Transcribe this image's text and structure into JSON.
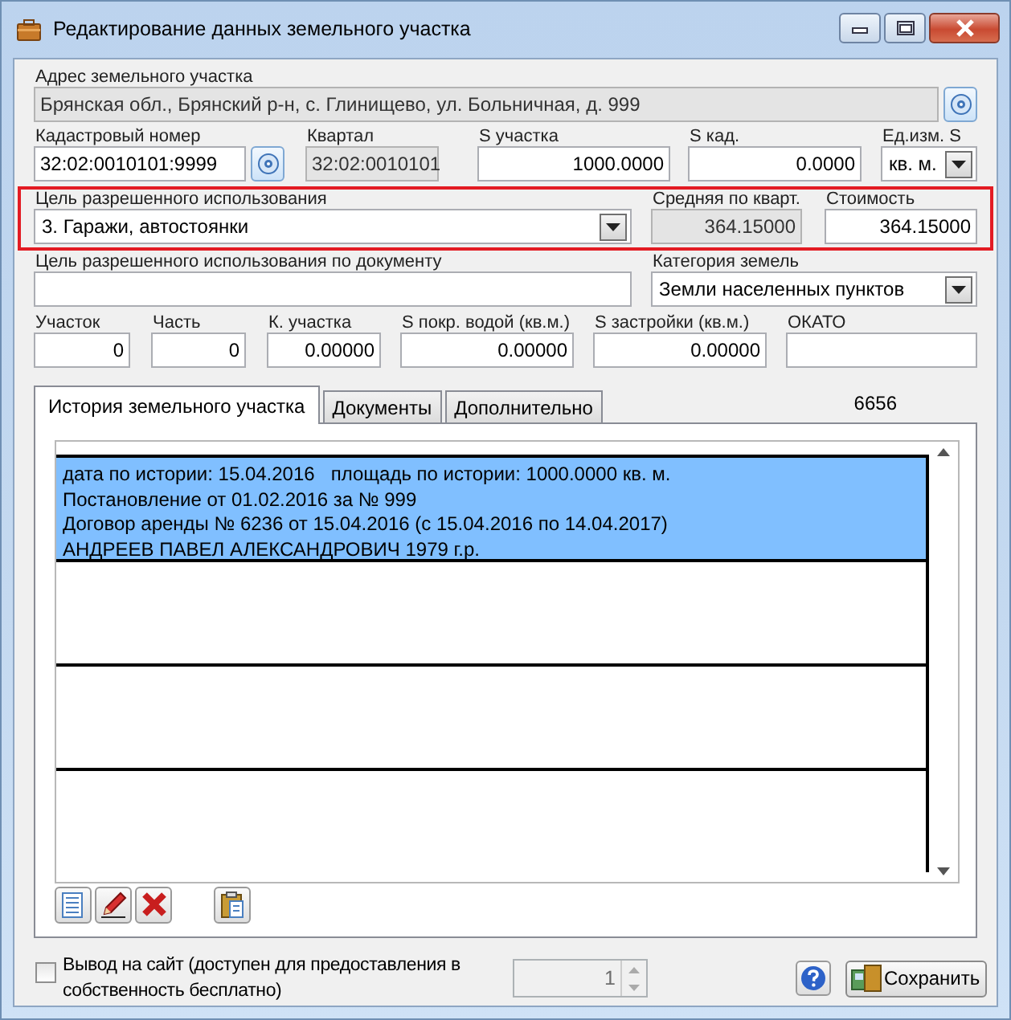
{
  "window": {
    "title": "Редактирование данных земельного участка"
  },
  "rows": [
    {
      "fields": [
        {
          "kind": "lookup",
          "label": "Адрес земельного участка",
          "value": "Брянская обл., Брянский р-н, с. Глинищево, ул. Больничная, д. 999",
          "readonly": true
        }
      ]
    },
    {
      "fields": [
        {
          "kind": "lookup",
          "label": "Кадастровый номер",
          "value": "32:02:0010101:9999",
          "readonly": false
        },
        {
          "kind": "text",
          "label": "Квартал",
          "value": "32:02:0010101",
          "readonly": true
        },
        {
          "kind": "number",
          "label": "S участка",
          "value": "1000.0000",
          "readonly": false
        },
        {
          "kind": "number",
          "label": "S кад.",
          "value": "0.0000",
          "readonly": false
        },
        {
          "kind": "select",
          "label": "Ед.изм. S",
          "value": "кв. м.",
          "readonly": false
        }
      ]
    },
    {
      "highlighted": true,
      "fields": [
        {
          "kind": "select",
          "label": "Цель разрешенного использования",
          "value": "3. Гаражи, автостоянки",
          "readonly": false
        },
        {
          "kind": "number",
          "label": "Средняя по кварт.",
          "value": "364.15000",
          "readonly": true
        },
        {
          "kind": "number",
          "label": "Стоимость",
          "value": "364.15000",
          "readonly": false
        }
      ]
    },
    {
      "fields": [
        {
          "kind": "text",
          "label": "Цель разрешенного использования по документу",
          "readonly": false
        },
        {
          "kind": "select",
          "label": "Категория земель",
          "value": "Земли населенных пунктов",
          "readonly": false
        }
      ]
    },
    {
      "fields": [
        {
          "kind": "number",
          "label": "Участок",
          "value": "0",
          "readonly": false
        },
        {
          "kind": "number",
          "label": "Часть",
          "value": "0",
          "readonly": false
        },
        {
          "kind": "number",
          "label": "К. участка",
          "value": "0.00000",
          "readonly": false
        },
        {
          "kind": "number",
          "label": "S покр. водой (кв.м.)",
          "value": "0.00000",
          "readonly": false
        },
        {
          "kind": "number",
          "label": "S застройки (кв.м.)",
          "value": "0.00000",
          "readonly": false
        },
        {
          "kind": "text",
          "label": "ОКАТО",
          "readonly": false
        }
      ]
    }
  ],
  "tabs": [
    {
      "label": "История земельного участка",
      "selected": true
    },
    {
      "label": "Документы",
      "selected": false
    },
    {
      "label": "Дополнительно",
      "selected": false
    }
  ],
  "counter": "6656",
  "history": [
    {
      "selected": true,
      "lines": [
        "дата по истории: 15.04.2016   площадь по истории: 1000.0000 кв. м.",
        "Постановление от 01.02.2016 за № 999",
        "Договор аренды № 6236 от 15.04.2016 (с 15.04.2016 по 14.04.2017)",
        "АНДРЕЕВ ПАВЕЛ АЛЕКСАНДРОВИЧ 1979 г.р."
      ]
    },
    {
      "selected": false
    },
    {
      "selected": false
    },
    {
      "selected": false
    }
  ],
  "toolbar": [
    {
      "kind": "add"
    },
    {
      "kind": "edit"
    },
    {
      "kind": "delete"
    },
    {
      "kind": "paste"
    }
  ],
  "publish": {
    "label": "Вывод на сайт (доступен для предоставления в собственность бесплатно)",
    "checked": false
  },
  "spinner": {
    "value": "1",
    "disabled": true
  },
  "save_button": {
    "label": "Сохранить"
  }
}
